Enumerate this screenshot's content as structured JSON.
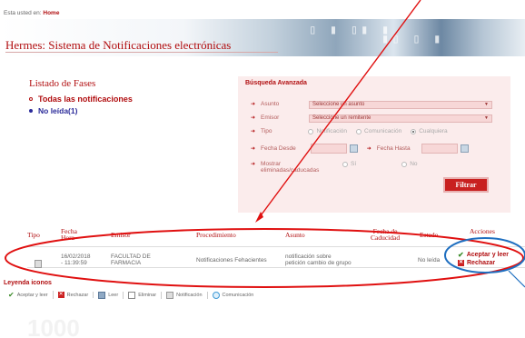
{
  "breadcrumb": {
    "prefix": "Esta usted en:",
    "current": "Home"
  },
  "app": {
    "title": "Hermes: Sistema de Notificaciones electrónicas"
  },
  "phases": {
    "title": "Listado de Fases",
    "items": [
      {
        "label": "Todas las notificaciones"
      },
      {
        "label": "No leída(1)"
      }
    ]
  },
  "search": {
    "title": "Búsqueda Avanzada",
    "asunto_label": "Asunto",
    "asunto_value": "Seleccione un asunto",
    "emisor_label": "Emisor",
    "emisor_value": "Seleccione un remitente",
    "tipo_label": "Tipo",
    "tipo_options": [
      "Notificación",
      "Comunicación",
      "Cualquiera"
    ],
    "tipo_selected": "Cualquiera",
    "fecha_desde_label": "Fecha Desde",
    "fecha_hasta_label": "Fecha Hasta",
    "mostrar_label_1": "Mostrar",
    "mostrar_label_2": "eliminadas/caducadas",
    "mostrar_options": [
      "Sí",
      "No"
    ],
    "filter_button": "Filtrar"
  },
  "table": {
    "headers": {
      "tipo": "Tipo",
      "fecha_1": "Fecha",
      "fecha_2": "Hora",
      "emisor": "Emisor",
      "procedimiento": "Procedimiento",
      "asunto": "Asunto",
      "caducidad_1": "Fecha de",
      "caducidad_2": "Caducidad",
      "estado": "Estado",
      "acciones": "Acciones"
    },
    "rows": [
      {
        "fecha": "16/02/2018",
        "hora": "- 11:39:59",
        "emisor_1": "FACULTAD DE",
        "emisor_2": "FARMACIA",
        "procedimiento": "Notificaciones Fehacientes",
        "asunto_1": "notificación sobre",
        "asunto_2": "petición cambio de grupo",
        "estado": "No leída",
        "accept": "Aceptar y leer",
        "reject": "Rechazar"
      }
    ]
  },
  "legend": {
    "title": "Leyenda iconos",
    "items": [
      {
        "label": "Aceptar y leer",
        "icon": "accept-icon"
      },
      {
        "label": "Rechazar",
        "icon": "reject-icon"
      },
      {
        "label": "Leer",
        "icon": "read-icon"
      },
      {
        "label": "Eliminar",
        "icon": "delete-icon"
      },
      {
        "label": "Notificación",
        "icon": "notification-icon"
      },
      {
        "label": "Comunicación",
        "icon": "communication-icon"
      }
    ]
  },
  "colors": {
    "accent": "#b10e10",
    "annotation_red": "#e01010",
    "annotation_blue": "#1f6fc0"
  }
}
